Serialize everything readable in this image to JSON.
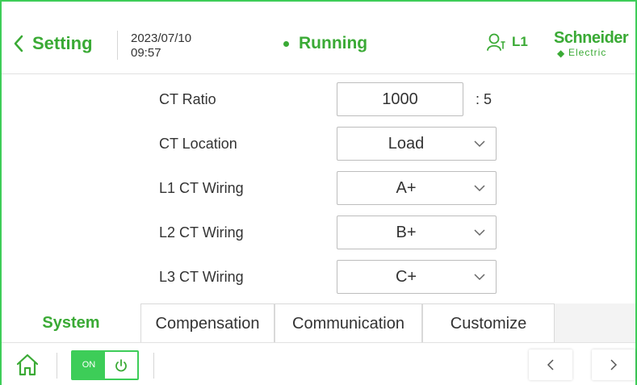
{
  "header": {
    "back_label": "Setting",
    "date": "2023/07/10",
    "time": "09:57",
    "status": "Running",
    "user_level": "L1",
    "logo_name": "Schneider",
    "logo_sub": "Electric"
  },
  "form": {
    "ct_ratio": {
      "label": "CT Ratio",
      "value": "1000",
      "suffix": ": 5"
    },
    "ct_location": {
      "label": "CT Location",
      "value": "Load"
    },
    "l1_wiring": {
      "label": "L1 CT Wiring",
      "value": "A+"
    },
    "l2_wiring": {
      "label": "L2 CT Wiring",
      "value": "B+"
    },
    "l3_wiring": {
      "label": "L3 CT Wiring",
      "value": "C+"
    }
  },
  "tabs": [
    {
      "label": "System",
      "active": true
    },
    {
      "label": "Compensation",
      "active": false
    },
    {
      "label": "Communication",
      "active": false
    },
    {
      "label": "Customize",
      "active": false
    }
  ],
  "bottom": {
    "toggle_label": "ON",
    "prev_icon": "chevron-left-icon",
    "next_icon": "chevron-right-icon",
    "home_icon": "home-icon"
  },
  "colors": {
    "accent": "#3aaa35",
    "frame": "#3dcd58"
  }
}
